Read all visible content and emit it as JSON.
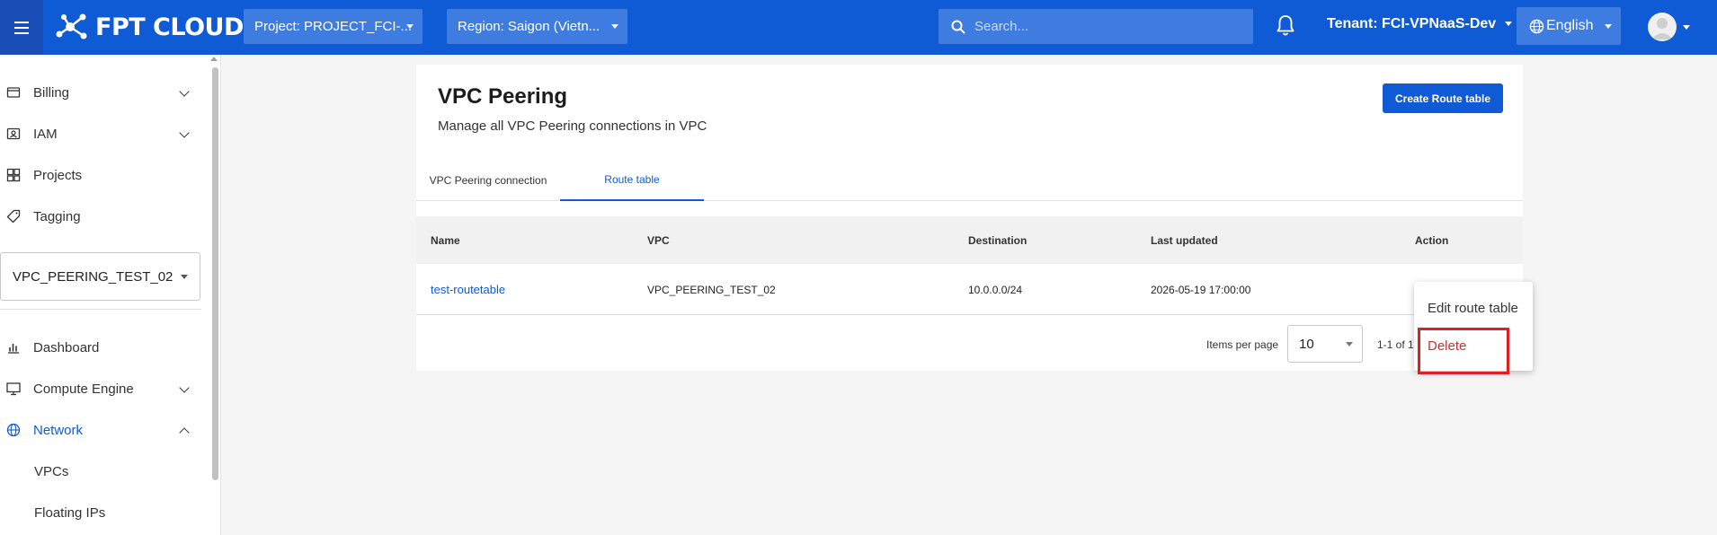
{
  "header": {
    "logo_text": "FPT CLOUD",
    "project_label": "Project: PROJECT_FCI-...",
    "region_label": "Region: Saigon (Vietn...",
    "search_placeholder": "Search...",
    "tenant_label": "Tenant: FCI-VPNaaS-Dev",
    "language": "English",
    "colors": {
      "brand": "#0f5bd6",
      "bar_control": "#3e7ce0"
    }
  },
  "sidebar": {
    "top_items": [
      {
        "label": "Billing",
        "icon": "wallet-icon"
      },
      {
        "label": "IAM",
        "icon": "id-card-icon"
      },
      {
        "label": "Projects",
        "icon": "projects-icon"
      },
      {
        "label": "Tagging",
        "icon": "tag-icon"
      }
    ],
    "project_select": "VPC_PEERING_TEST_02",
    "nav_items": [
      {
        "label": "Dashboard",
        "icon": "bar-chart-icon"
      },
      {
        "label": "Compute Engine",
        "icon": "monitor-icon"
      },
      {
        "label": "Network",
        "icon": "globe-icon"
      }
    ],
    "network_sub_items": [
      "VPCs",
      "Floating IPs"
    ]
  },
  "page": {
    "title": "VPC Peering",
    "subtitle": "Manage all VPC Peering connections in VPC",
    "create_button": "Create Route table",
    "tabs": [
      "VPC Peering connection",
      "Route table"
    ],
    "active_tab": "Route table"
  },
  "table": {
    "headers": [
      "Name",
      "VPC",
      "Destination",
      "Last updated",
      "Action"
    ],
    "rows": [
      {
        "name": "test-routetable",
        "vpc": "VPC_PEERING_TEST_02",
        "destination": "10.0.0.0/24",
        "last_updated": "2026-05-19 17:00:00"
      }
    ]
  },
  "pagination": {
    "items_per_page_label": "Items per page",
    "page_size": "10",
    "range_text": "1-1 of 1"
  },
  "action_menu": {
    "edit_label": "Edit route table",
    "delete_label": "Delete",
    "delete_color": "#d32f2f"
  }
}
